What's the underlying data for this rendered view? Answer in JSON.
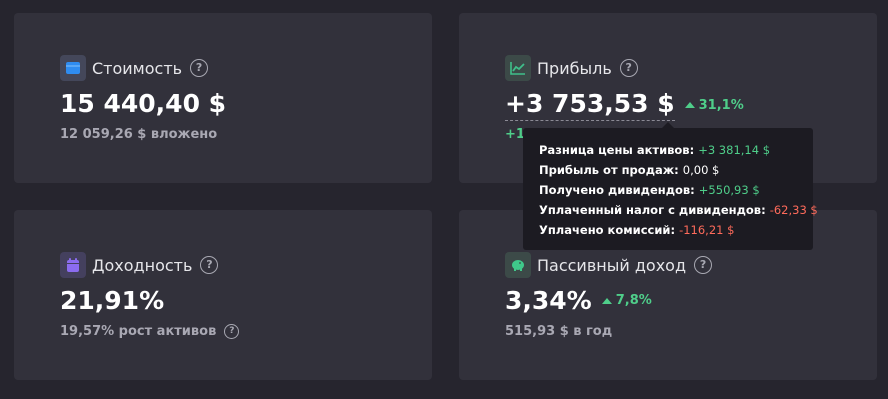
{
  "cards": {
    "value": {
      "title": "Стоимость",
      "amount": "15 440,40 $",
      "sub": "12 059,26 $ вложено"
    },
    "profit": {
      "title": "Прибыль",
      "amount": "+3 753,53 $",
      "delta": "31,1%",
      "sub_partial": "+1"
    },
    "yield": {
      "title": "Доходность",
      "amount": "21,91%",
      "sub": "19,57% рост активов"
    },
    "passive": {
      "title": "Пассивный доход",
      "amount": "3,34%",
      "delta": "7,8%",
      "sub": "515,93 $ в год"
    }
  },
  "tooltip": {
    "rows": [
      {
        "label": "Разница цены активов:",
        "value": "+3 381,14 $"
      },
      {
        "label": "Прибыль от продаж:",
        "value": "0,00 $"
      },
      {
        "label": "Получено дивидендов:",
        "value": "+550,93 $"
      },
      {
        "label": "Уплаченный налог с дивидендов:",
        "value": "-62,33 $"
      },
      {
        "label": "Уплачено комиссий:",
        "value": "-116,21 $"
      }
    ]
  },
  "help_symbol": "?",
  "colors": {
    "background": "#26252e",
    "card": "#32313b",
    "positive": "#4fce8a",
    "negative": "#ff6b5b",
    "tooltip": "#1c1b22",
    "wallet_icon": "#2f8cf0",
    "chart_icon": "#3fbf8a",
    "calendar_icon": "#8b6cf0",
    "piggy_icon": "#3fc98a"
  },
  "icons": {
    "value": "wallet-icon",
    "profit": "chart-line-icon",
    "yield": "calendar-icon",
    "passive": "piggy-bank-icon"
  }
}
